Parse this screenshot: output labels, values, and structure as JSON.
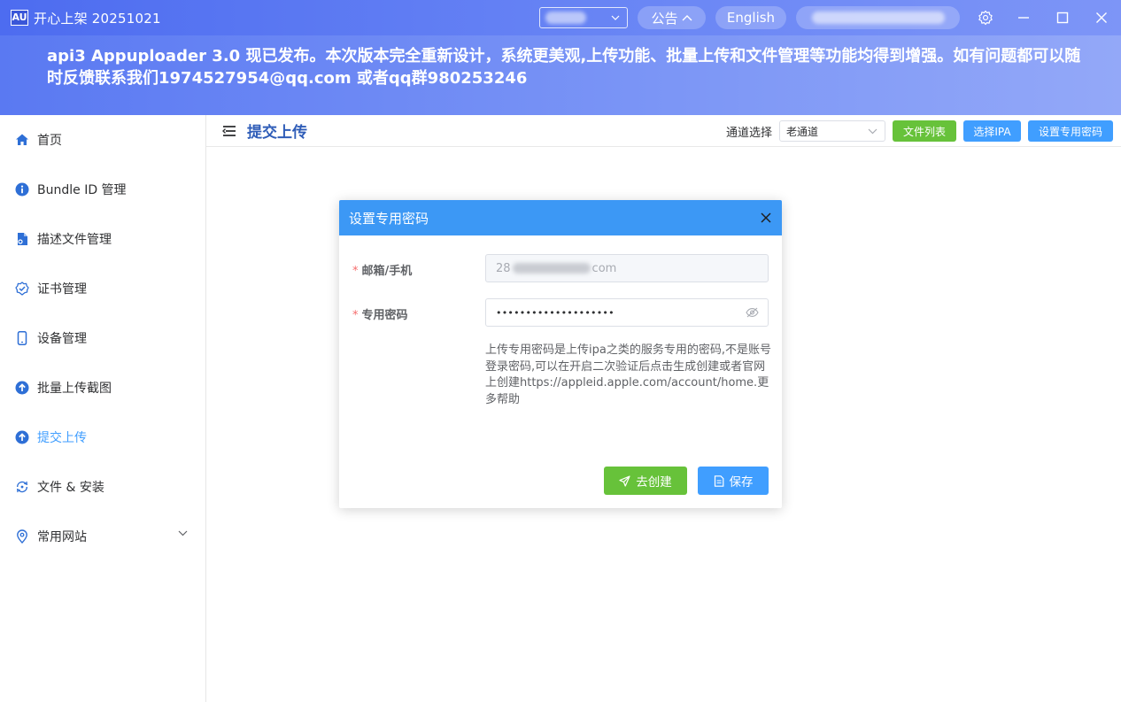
{
  "window": {
    "logo_text": "AU",
    "title": "开心上架 20251021",
    "notice_label": "公告",
    "language_label": "English"
  },
  "banner": {
    "text": "api3 Appuploader 3.0 现已发布。本次版本完全重新设计，系统更美观,上传功能、批量上传和文件管理等功能均得到增强。如有问题都可以随时反馈联系我们1974527954@qq.com 或者qq群980253246"
  },
  "sidebar": {
    "items": [
      {
        "label": "首页",
        "icon": "home-icon"
      },
      {
        "label": "Bundle ID 管理",
        "icon": "info-icon"
      },
      {
        "label": "描述文件管理",
        "icon": "file-icon"
      },
      {
        "label": "证书管理",
        "icon": "certificate-icon"
      },
      {
        "label": "设备管理",
        "icon": "phone-icon"
      },
      {
        "label": "批量上传截图",
        "icon": "upload-icon"
      },
      {
        "label": "提交上传",
        "icon": "upload-icon",
        "active": true
      },
      {
        "label": "文件 & 安装",
        "icon": "sync-icon"
      },
      {
        "label": "常用网站",
        "icon": "location-icon"
      }
    ]
  },
  "main": {
    "page_title": "提交上传",
    "channel_label": "通道选择",
    "channel_value": "老通道",
    "file_list_button": "文件列表",
    "select_ipa_button": "选择IPA",
    "set_password_button": "设置专用密码"
  },
  "dialog": {
    "title": "设置专用密码",
    "email_label": "邮箱/手机",
    "email_prefix": "28",
    "email_suffix": "com",
    "password_label": "专用密码",
    "password_value": "••••••••••••••••••••",
    "required_mark": "*",
    "help_text": "上传专用密码是上传ipa之类的服务专用的密码,不是账号登录密码,可以在开启二次验证后点击生成创建或者官网上创建https://appleid.apple.com/account/home.更多帮助",
    "create_button": "去创建",
    "save_button": "保存"
  },
  "colors": {
    "titlebar": "#4d6cf0",
    "accent_blue": "#409eff",
    "accent_green": "#67c23a",
    "dialog_header": "#3c98f5",
    "page_title": "#2f5db8",
    "required": "#f56c6c"
  }
}
